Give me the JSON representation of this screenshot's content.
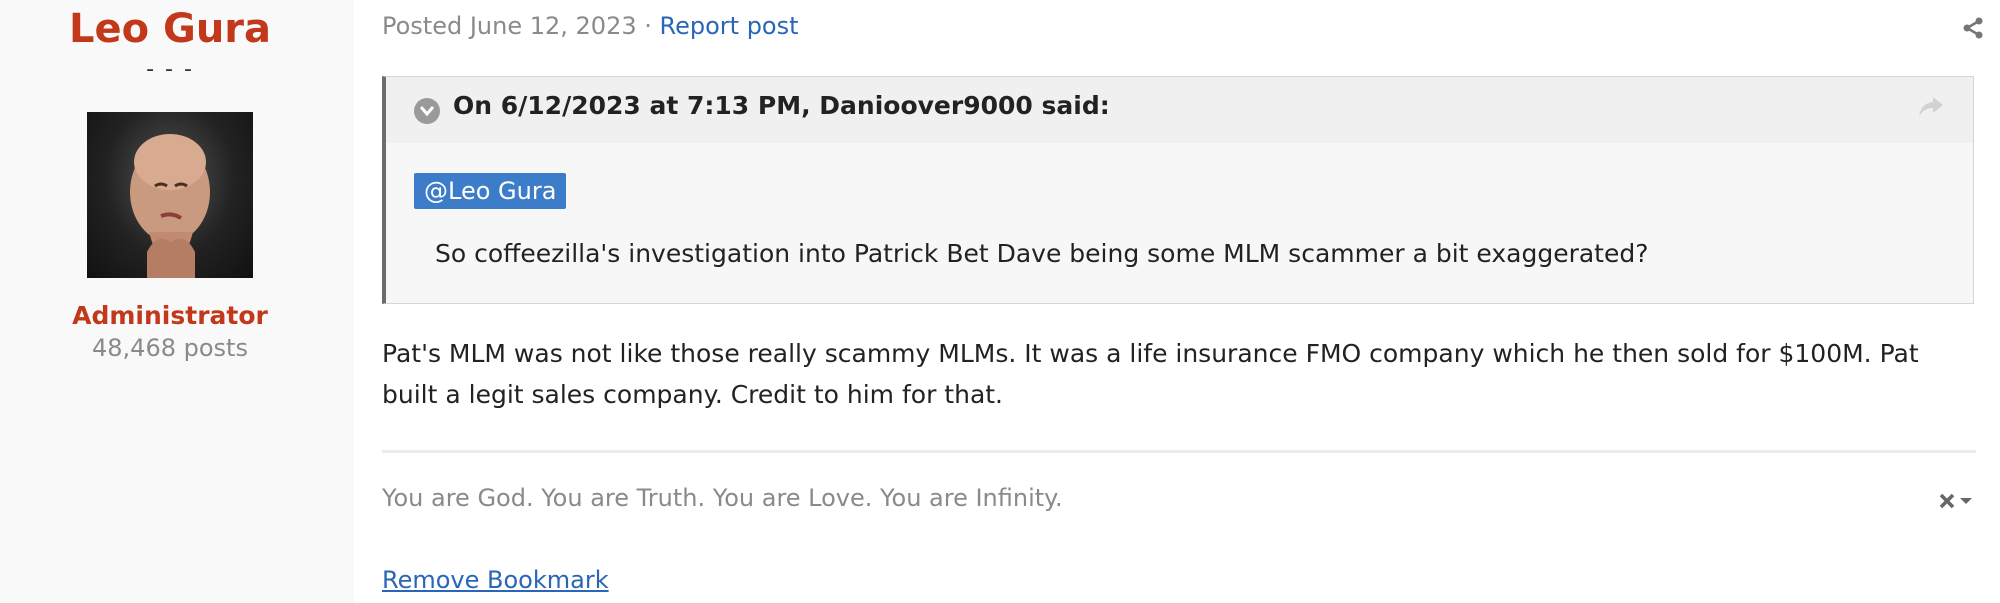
{
  "author": {
    "name": "Leo Gura",
    "title": "- - -",
    "group": "Administrator",
    "post_count": "48,468 posts"
  },
  "post": {
    "posted_label": "Posted June 12, 2023 · ",
    "report_link": "Report post",
    "quote": {
      "citation": "On 6/12/2023 at 7:13 PM, Danioover9000 said:",
      "mention": "@Leo Gura",
      "text": "So coffeezilla's investigation into Patrick Bet Dave being some MLM scammer a bit exaggerated?"
    },
    "body": "Pat's MLM was not like those really scammy MLMs. It was a life insurance FMO company which he then sold for $100M. Pat built a legit sales company. Credit to him for that.",
    "signature": "You are God. You are Truth. You are Love. You are Infinity.",
    "bookmark_link": "Remove Bookmark"
  },
  "icons": {
    "share": "share-icon",
    "quote_toggle": "chevron-down-circle-icon",
    "quote_jump": "share-arrow-icon",
    "signature_close": "close-icon",
    "signature_menu": "caret-down-icon"
  },
  "colors": {
    "author_name": "#c1391a",
    "link": "#2a66b8",
    "mention_bg": "#3d7cc9",
    "muted": "#8a8a8a"
  }
}
